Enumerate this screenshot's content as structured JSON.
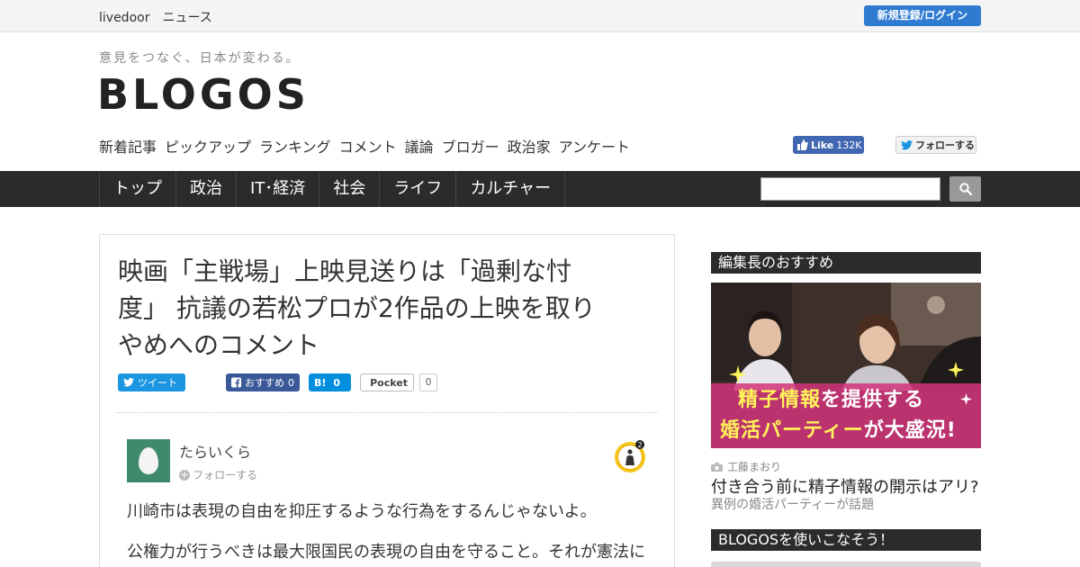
{
  "topbar": {
    "brand": "livedoor　ニュース",
    "login_label": "新規登録/ログイン"
  },
  "header": {
    "tagline": "意見をつなぐ、日本が変わる。",
    "logo": "BLOGOS"
  },
  "subnav": [
    "新着記事",
    "ピックアップ",
    "ランキング",
    "コメント",
    "議論",
    "ブロガー",
    "政治家",
    "アンケート"
  ],
  "social": {
    "fb_like_label": "Like",
    "fb_like_count": "132K",
    "twitter_follow_label": "フォローする"
  },
  "mainnav": [
    "トップ",
    "政治",
    "IT･経済",
    "社会",
    "ライフ",
    "カルチャー"
  ],
  "search": {
    "placeholder": ""
  },
  "article": {
    "headline_lines": [
      "映画「主戦場」上映見送りは「過剰な忖",
      "度」 抗議の若松プロが2作品の上映を取り",
      "やめへのコメント"
    ],
    "share": {
      "tweet": "ツイート",
      "fb": "おすすめ",
      "fb_count": "0",
      "hatena_mark": "B!",
      "hatena_count": "0",
      "pocket": "Pocket",
      "pocket_count": "0"
    },
    "author": {
      "name": "たらいくら",
      "follow_label": "フォローする",
      "medal_count": "2"
    },
    "body": [
      "川崎市は表現の自由を抑圧するような行為をするんじゃないよ。",
      "公権力が行うべきは最大限国民の表現の自由を守ること。それが憲法に"
    ]
  },
  "sidebar": {
    "heading1": "編集長のおすすめ",
    "promo": {
      "line1_hl": "精子情報",
      "line1_rest": "を提供する",
      "line2_hl": "婚活パーティー",
      "line2_rest": "が大盛況!"
    },
    "credit": "工藤まおり",
    "title": "付き合う前に精子情報の開示はアリ?",
    "subtitle": "異例の婚活パーティーが話題",
    "heading2": "BLOGOSを使いこなそう！"
  },
  "colors": {
    "accent_blue": "#2f7bd2",
    "nav_dark": "#2b2b2b",
    "fb": "#3b5998",
    "twitter": "#1b95e0",
    "hatena": "#008fde"
  }
}
